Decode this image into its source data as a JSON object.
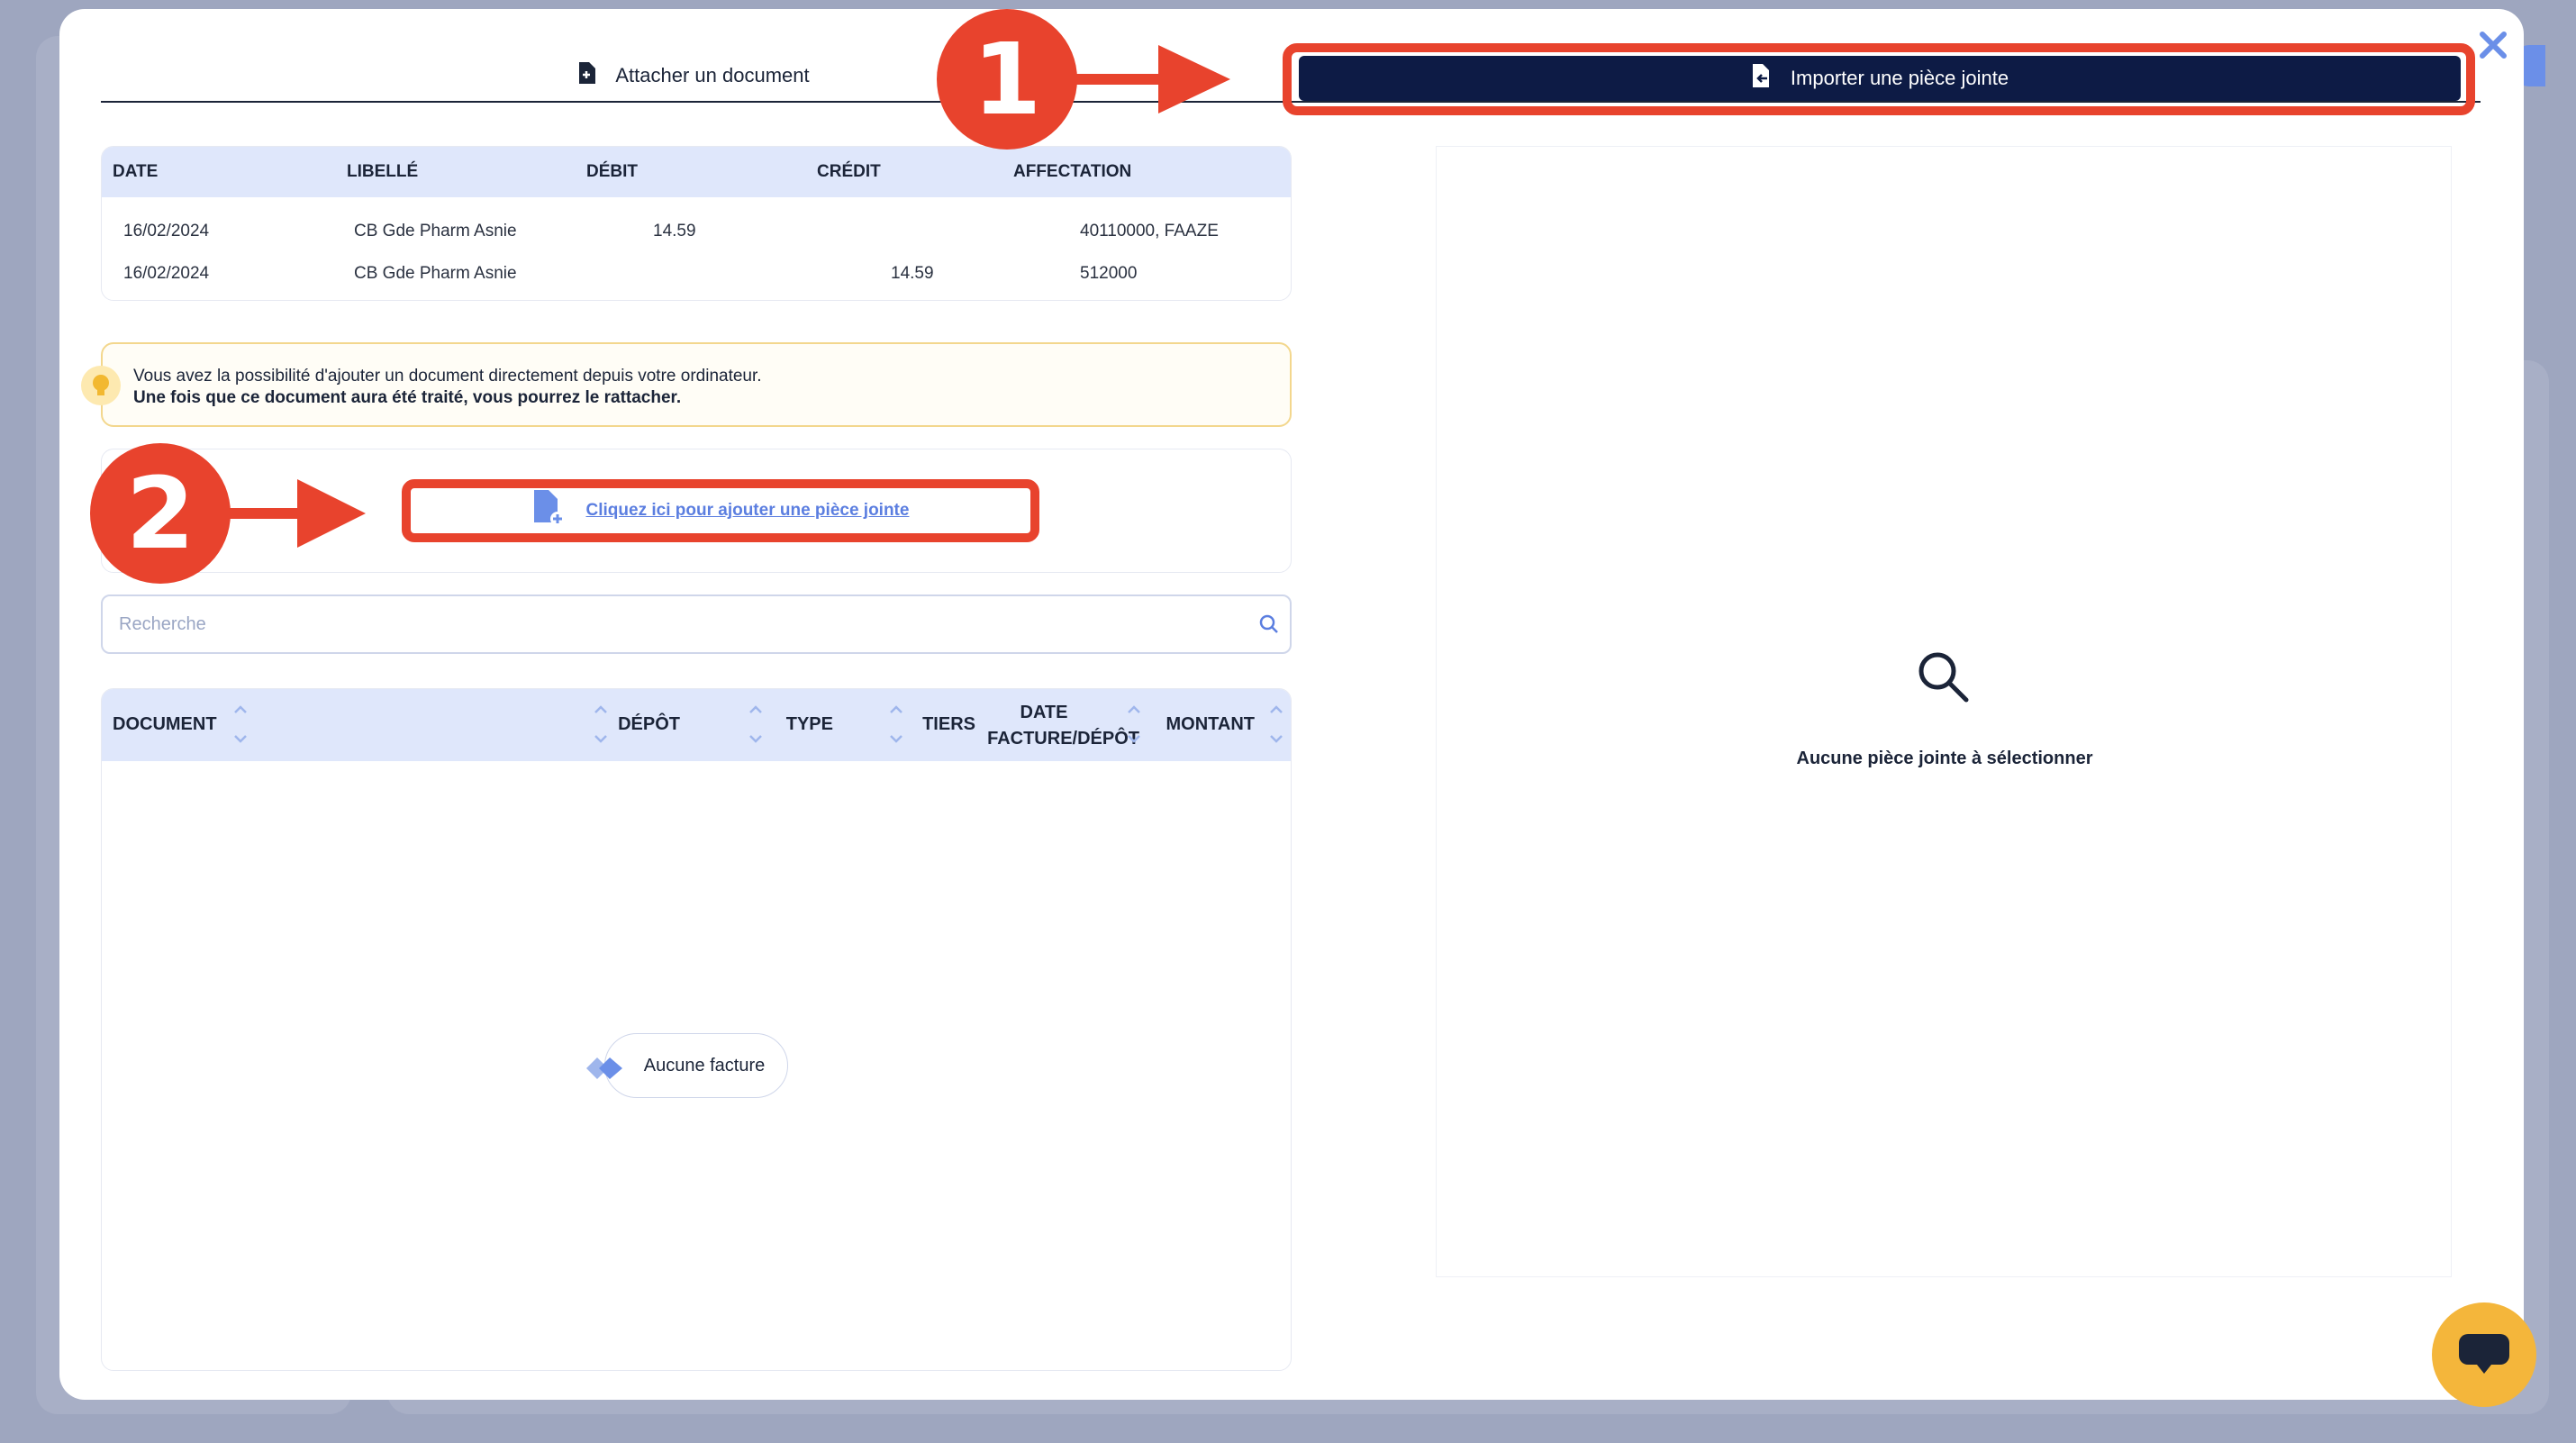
{
  "tabs": {
    "attach_label": "Attacher un document",
    "import_label": "Importer une pièce jointe"
  },
  "transactions": {
    "columns": [
      "DATE",
      "LIBELLÉ",
      "DÉBIT",
      "CRÉDIT",
      "AFFECTATION"
    ],
    "rows": [
      {
        "date": "16/02/2024",
        "label": "CB Gde Pharm Asnie",
        "debit": "14.59",
        "credit": "",
        "affectation": "40110000, FAAZE"
      },
      {
        "date": "16/02/2024",
        "label": "CB Gde Pharm Asnie",
        "debit": "",
        "credit": "14.59",
        "affectation": "512000"
      }
    ]
  },
  "info": {
    "line1": "Vous avez la possibilité d'ajouter un document directement depuis votre ordinateur.",
    "line2": "Une fois que ce document aura été traité, vous pourrez le rattacher."
  },
  "upload": {
    "label": "Cliquez ici pour ajouter une pièce jointe"
  },
  "search": {
    "placeholder": "Recherche"
  },
  "documents": {
    "columns": {
      "document": "DOCUMENT",
      "depot": "DÉPÔT",
      "type": "TYPE",
      "tiers": "TIERS",
      "date_line1": "DATE",
      "date_line2": "FACTURE/DÉPÔT",
      "montant": "MONTANT"
    },
    "empty": "Aucune facture"
  },
  "preview": {
    "empty": "Aucune pièce jointe à sélectionner"
  },
  "annotations": {
    "step1": "1",
    "step2": "2"
  },
  "colors": {
    "accent_red": "#e8432d",
    "navy": "#0d1b45",
    "header_blue": "#dfe7fb",
    "link_blue": "#5b7ee0",
    "chat_yellow": "#f4b63b"
  },
  "icons": {
    "close": "close-icon",
    "attach": "file-icon",
    "import": "file-import-icon",
    "bulb": "lightbulb-icon",
    "upload": "file-add-icon",
    "search": "search-icon",
    "preview": "search-icon",
    "chat": "chat-icon"
  }
}
